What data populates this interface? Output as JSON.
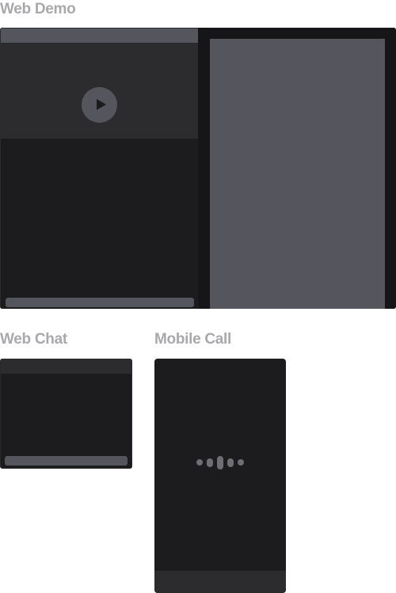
{
  "labels": {
    "web_demo": "Web Demo",
    "web_chat": "Web Chat",
    "mobile_call": "Mobile Call"
  },
  "icons": {
    "video": "play-icon",
    "call": "audio-waveform-icon"
  },
  "colors": {
    "label": "#a8a8ad",
    "frame_bg": "#1c1c1e",
    "header_bar": "#55555d",
    "panel": "#2c2c2e",
    "panel_dark": "#161618",
    "preview": "#55555d",
    "input_bar": "#55555d",
    "play_circle": "#55555d",
    "wave": "#6e6e74"
  }
}
